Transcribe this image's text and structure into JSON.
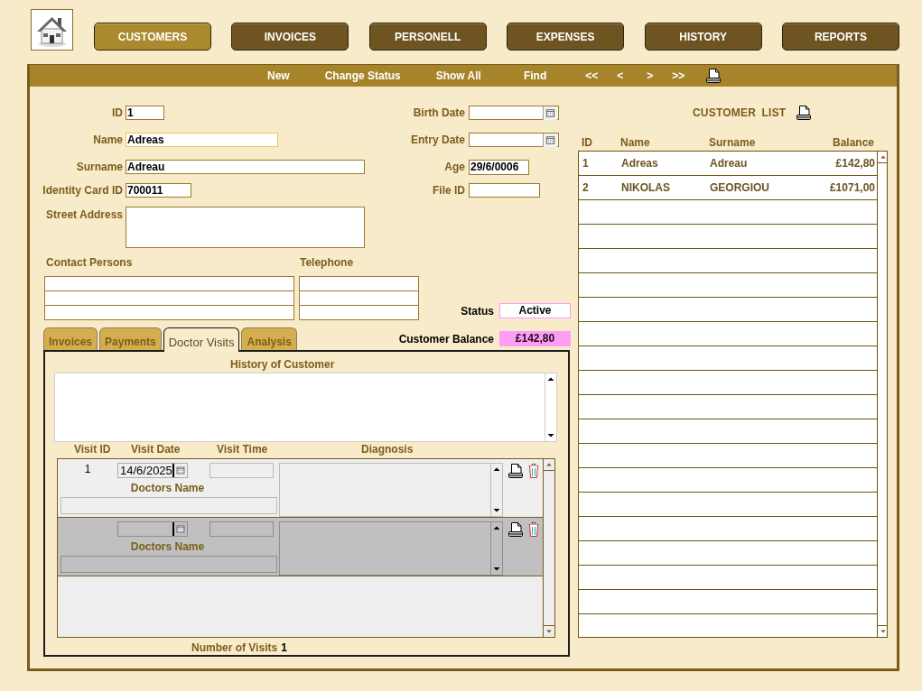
{
  "nav": [
    {
      "label": "CUSTOMERS",
      "selected": true
    },
    {
      "label": "INVOICES",
      "selected": false
    },
    {
      "label": "PERSONELL",
      "selected": false
    },
    {
      "label": "EXPENSES",
      "selected": false
    },
    {
      "label": "HISTORY",
      "selected": false
    },
    {
      "label": "REPORTS",
      "selected": false
    }
  ],
  "toolbar": [
    "New",
    "Change Status",
    "Show All",
    "Find",
    "<<",
    "<",
    ">",
    ">>"
  ],
  "fields_left": [
    {
      "label": "ID",
      "value": "1",
      "kind": "text",
      "focused": false
    },
    {
      "label": "Name",
      "value": "Adreas",
      "kind": "text",
      "focused": true
    },
    {
      "label": "Surname",
      "value": "Adreau",
      "kind": "text",
      "focused": false
    },
    {
      "label": "Identity Card ID",
      "value": "700011",
      "kind": "text",
      "focused": false
    },
    {
      "label": "Street Address",
      "kind": "textarea",
      "focused": false
    }
  ],
  "fields_right": [
    {
      "label": "Birth Date",
      "kind": "date",
      "focused": false
    },
    {
      "label": "Entry Date",
      "kind": "date",
      "focused": false
    },
    {
      "label": "Age",
      "value": "29/6/0006",
      "kind": "text",
      "focused": false
    },
    {
      "label": "File ID",
      "kind": "text",
      "focused": false
    }
  ],
  "contacts": {
    "columns": [
      "Contact Persons",
      "Telephone"
    ]
  },
  "status": {
    "label": "Status",
    "value": "Active"
  },
  "balance": {
    "label": "Customer Balance",
    "value": "£142,80"
  },
  "tabs": [
    {
      "label": "Invoices",
      "selected": false
    },
    {
      "label": "Payments",
      "selected": false
    },
    {
      "label": "Doctor Visits",
      "selected": true
    },
    {
      "label": "Analysis",
      "selected": false
    }
  ],
  "doctor_visits": {
    "history_label": "History of Customer",
    "columns": [
      "Visit ID",
      "Visit Date",
      "Visit Time",
      "Diagnosis"
    ],
    "rows": [
      {
        "selected": false,
        "visit_id": "1",
        "visit_date": "14/6/2025",
        "doctor_label": "Doctors Name"
      },
      {
        "selected": true,
        "doctor_label": "Doctors Name"
      }
    ],
    "count_label": "Number of Visits",
    "count": "1"
  },
  "customer_list": {
    "title": "CUSTOMER LIST",
    "columns": [
      "ID",
      "Name",
      "Surname",
      "Balance"
    ],
    "rows": [
      [
        "1",
        "Adreas",
        "Adreau",
        "£142,80"
      ],
      [
        "2",
        "NIKOLAS",
        "GEORGIOU",
        "£1071,00"
      ]
    ]
  }
}
